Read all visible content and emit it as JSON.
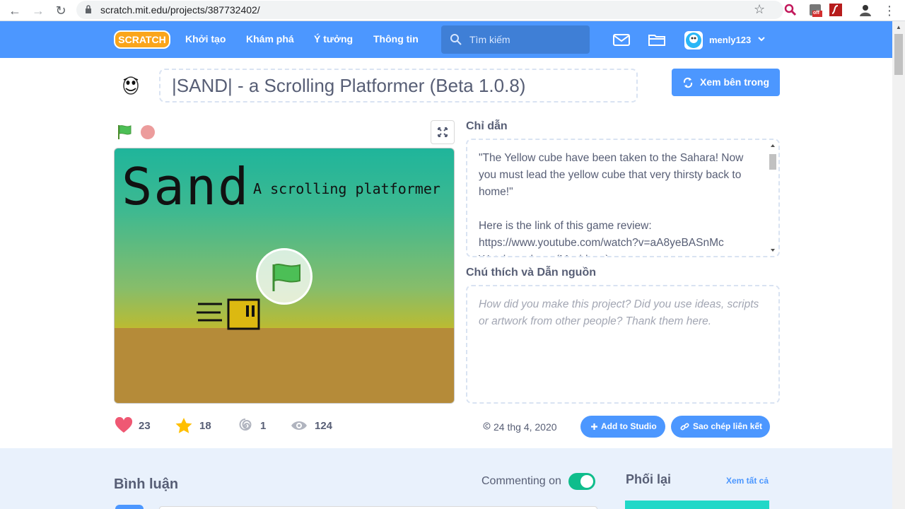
{
  "browser": {
    "url": "scratch.mit.edu/projects/387732402/",
    "ext_badge": "off"
  },
  "nav": {
    "logo": "SCRATCH",
    "links": [
      "Khởi tạo",
      "Khám phá",
      "Ý tưởng",
      "Thông tin"
    ],
    "search_placeholder": "Tìm kiếm",
    "username": "menly123"
  },
  "project": {
    "title": "|SAND| - a Scrolling Platformer (Beta 1.0.8)",
    "see_inside": "Xem bên trong",
    "stage_title": "Sand",
    "stage_subtitle": "A scrolling platformer",
    "instructions_label": "Chỉ dẫn",
    "instructions": "\"The Yellow cube have been taken to the Sahara! Now you must lead the yellow cube that very thirsty back to home!\"\n\nHere is the link of this game review:\nhttps://www.youtube.com/watch?v=aA8yeBASnMc\nWatch me here (Myvideos):",
    "notes_label": "Chú thích và Dẫn nguồn",
    "notes_placeholder": "How did you make this project? Did you use ideas, scripts or artwork from other people? Thank them here."
  },
  "stats": {
    "loves": "23",
    "favorites": "18",
    "remixes": "1",
    "views": "124",
    "date": "24 thg 4, 2020",
    "add_to_studio": "Add to Studio",
    "copy_link": "Sao chép liên kết"
  },
  "bottom": {
    "comments_title": "Bình luận",
    "commenting_label": "Commenting on",
    "remixes_title": "Phối lại",
    "view_all": "Xem tất cả"
  },
  "colors": {
    "brand": "#4c97ff",
    "toggle_on": "#0fbd8c",
    "text": "#575e75"
  }
}
